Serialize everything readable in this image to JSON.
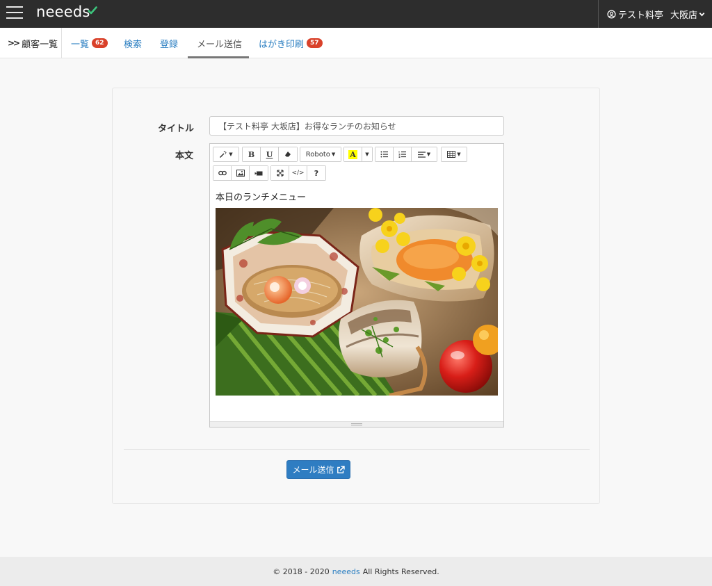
{
  "header": {
    "brand": "neeeds",
    "user_name": "テスト料亭",
    "store_name": "大阪店"
  },
  "nav": {
    "breadcrumb": "顧客一覧",
    "tabs": [
      {
        "label": "一覧",
        "badge": "62"
      },
      {
        "label": "検索"
      },
      {
        "label": "登録"
      },
      {
        "label": "メール送信",
        "active": true
      },
      {
        "label": "はがき印刷",
        "badge": "57"
      }
    ]
  },
  "form": {
    "title_label": "タイトル",
    "title_value": "【テスト料亭 大坂店】お得なランチのお知らせ",
    "body_label": "本文",
    "body_text": "本日のランチメニュー",
    "font_name": "Roboto",
    "send_button": "メール送信"
  },
  "toolbar": {
    "bold": "B",
    "underline": "U",
    "help": "?"
  },
  "footer": {
    "prefix": "© 2018 - 2020",
    "brand_link": "neeeds",
    "suffix": "All Rights Reserved."
  },
  "colors": {
    "header_bg": "#2d2d2d",
    "accent": "#2f7dc2",
    "badge": "#d9412a",
    "brand_check": "#3cc47c"
  }
}
